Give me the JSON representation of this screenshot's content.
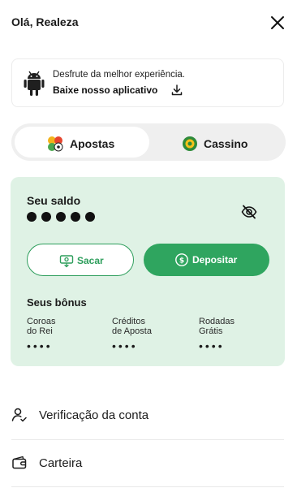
{
  "header": {
    "greeting": "Olá, Realeza",
    "close_icon": "close-icon"
  },
  "app_banner": {
    "line1": "Desfrute da melhor experiência.",
    "line2": "Baixe nosso aplicativo",
    "icons": [
      "android-icon",
      "download-icon"
    ]
  },
  "tabs": [
    {
      "label": "Apostas",
      "icon": "sports-balls-icon",
      "selected": true
    },
    {
      "label": "Cassino",
      "icon": "casino-chip-icon",
      "selected": false
    }
  ],
  "balance": {
    "label": "Seu saldo",
    "visibility_icon": "eye-off-icon",
    "hidden": true,
    "withdraw_label": "Sacar",
    "deposit_label": "Depositar",
    "bonus_title": "Seus bônus",
    "bonuses": [
      {
        "label": "Coroas\ndo Rei",
        "value": "••••"
      },
      {
        "label": "Créditos\nde Aposta",
        "value": "••••"
      },
      {
        "label": "Rodadas\nGrátis",
        "value": "••••"
      }
    ]
  },
  "menu": [
    {
      "label": "Verificação da conta",
      "icon": "user-check-icon"
    },
    {
      "label": "Carteira",
      "icon": "wallet-icon"
    }
  ],
  "colors": {
    "accent": "#2fa55f",
    "card_bg": "#dff2e5",
    "tab_bg": "#efefef"
  }
}
